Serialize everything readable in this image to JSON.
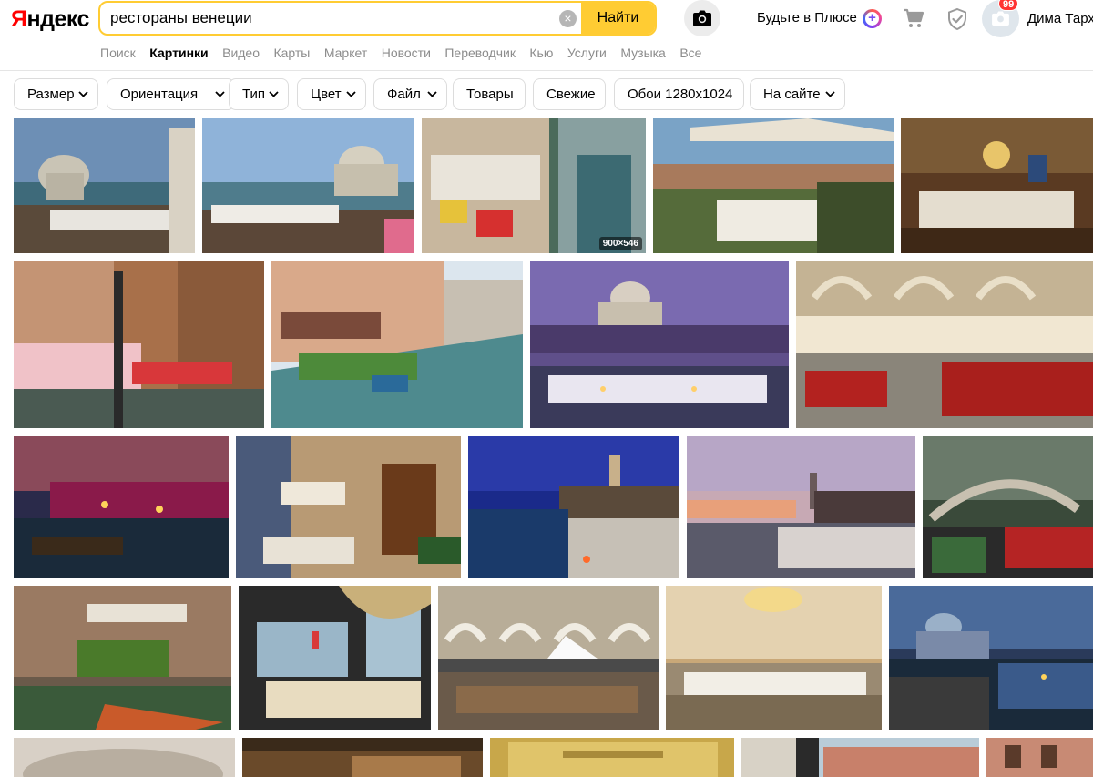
{
  "logo": {
    "text_y": "Я",
    "text_rest": "ндекс"
  },
  "search": {
    "query": "рестораны венеции",
    "clear_symbol": "×",
    "submit_label": "Найти"
  },
  "header": {
    "camera_icon": "camera-icon",
    "plus_label": "Будьте в Плюсе",
    "plus_symbol": "+",
    "cart_icon": "cart-icon",
    "shield_icon": "shield-icon",
    "notifications_count": "99",
    "user_name": "Дима Тарх"
  },
  "services": [
    {
      "label": "Поиск",
      "active": false
    },
    {
      "label": "Картинки",
      "active": true
    },
    {
      "label": "Видео",
      "active": false
    },
    {
      "label": "Карты",
      "active": false
    },
    {
      "label": "Маркет",
      "active": false
    },
    {
      "label": "Новости",
      "active": false
    },
    {
      "label": "Переводчик",
      "active": false
    },
    {
      "label": "Кью",
      "active": false
    },
    {
      "label": "Услуги",
      "active": false
    },
    {
      "label": "Музыка",
      "active": false
    },
    {
      "label": "Все",
      "active": false
    }
  ],
  "filters": [
    {
      "label": "Размер",
      "dropdown": true
    },
    {
      "label": "Ориентация",
      "dropdown": true
    },
    {
      "label": "Тип",
      "dropdown": true
    },
    {
      "label": "Цвет",
      "dropdown": true
    },
    {
      "label": "Файл",
      "dropdown": true
    },
    {
      "label": "Товары",
      "dropdown": false
    },
    {
      "label": "Свежие",
      "dropdown": false
    },
    {
      "label": "Обои 1280х1024",
      "dropdown": false
    },
    {
      "label": "На сайте",
      "dropdown": true
    }
  ],
  "hovered_image_size": "900×546",
  "colors": {
    "search_accent": "#ffcc33",
    "logo_red": "#ff0000",
    "badge_red": "#ff3333",
    "muted_text": "#8c8c8c"
  }
}
